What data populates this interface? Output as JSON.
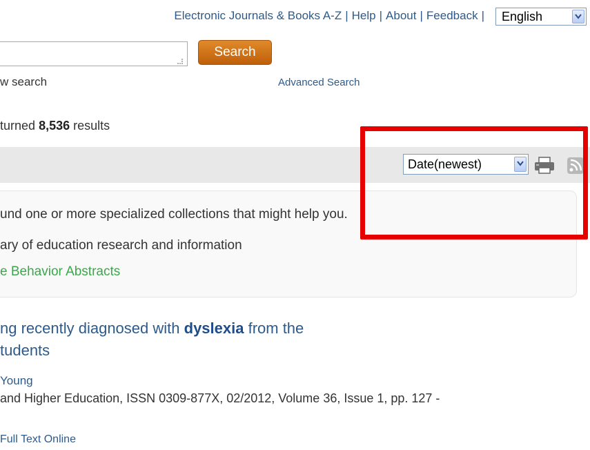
{
  "top_nav": {
    "links": [
      "Electronic Journals & Books A-Z",
      "Help",
      "About",
      "Feedback"
    ],
    "language": "English"
  },
  "search": {
    "button_label": "Search",
    "new_search_partial": "w search",
    "advanced_label": "Advanced Search"
  },
  "results": {
    "prefix": "turned",
    "count": "8,536",
    "suffix": "results"
  },
  "toolbar": {
    "sort_value": "Date(newest)"
  },
  "collections": {
    "intro": "und one or more specialized collections that might help you.",
    "item1": "ary of education research and information",
    "item2": "e Behavior Abstracts"
  },
  "result": {
    "title_pre": "ng recently diagnosed with ",
    "title_highlight": "dyslexia",
    "title_post": " from the",
    "title_line2": "tudents",
    "author": "Young",
    "publication": "and Higher Education, ISSN 0309-877X, 02/2012, Volume 36, Issue 1, pp. 127 -",
    "full_text": "Full Text Online"
  },
  "colors": {
    "accent_link": "#2d5a8a",
    "search_button": "#d1721a",
    "highlight_box": "#e60000",
    "collection_link": "#3aa84a"
  }
}
